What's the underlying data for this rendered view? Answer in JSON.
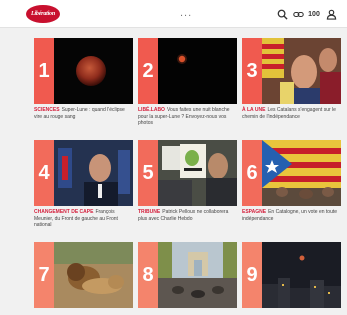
{
  "header": {
    "logo_text": "Libération",
    "more_label": "...",
    "tools": {
      "search_icon": "search-icon",
      "link_icon": "link-icon",
      "badge_text": "100",
      "user_icon": "user-icon"
    }
  },
  "articles": [
    {
      "num": "1",
      "kicker": "Sciences",
      "title": "Super-Lune : quand l'éclipse vire au rouge sang"
    },
    {
      "num": "2",
      "kicker": "Libé.Labo",
      "title": "Vous faites une nuit blanche pour la super-Lune ? Envoyez-nous vos photos"
    },
    {
      "num": "3",
      "kicker": "À la Une",
      "title": "Les Catalans s'engagent sur le chemin de l'indépendance"
    },
    {
      "num": "4",
      "kicker": "Changement de cape",
      "title": "François Meunier, du Front de gauche au Front national"
    },
    {
      "num": "5",
      "kicker": "Tribune",
      "title": "Patrick Pelloux ne collaborera plus avec Charlie Hebdo"
    },
    {
      "num": "6",
      "kicker": "Espagne",
      "title": "En Catalogne, un vote en toute indépendance"
    },
    {
      "num": "7",
      "kicker": "",
      "title": ""
    },
    {
      "num": "8",
      "kicker": "",
      "title": ""
    },
    {
      "num": "9",
      "kicker": "",
      "title": ""
    }
  ],
  "colors": {
    "accent": "#d4213d",
    "number_band": "#f26b5b",
    "topbar": "#ffffff",
    "background": "#f1f1f1"
  }
}
